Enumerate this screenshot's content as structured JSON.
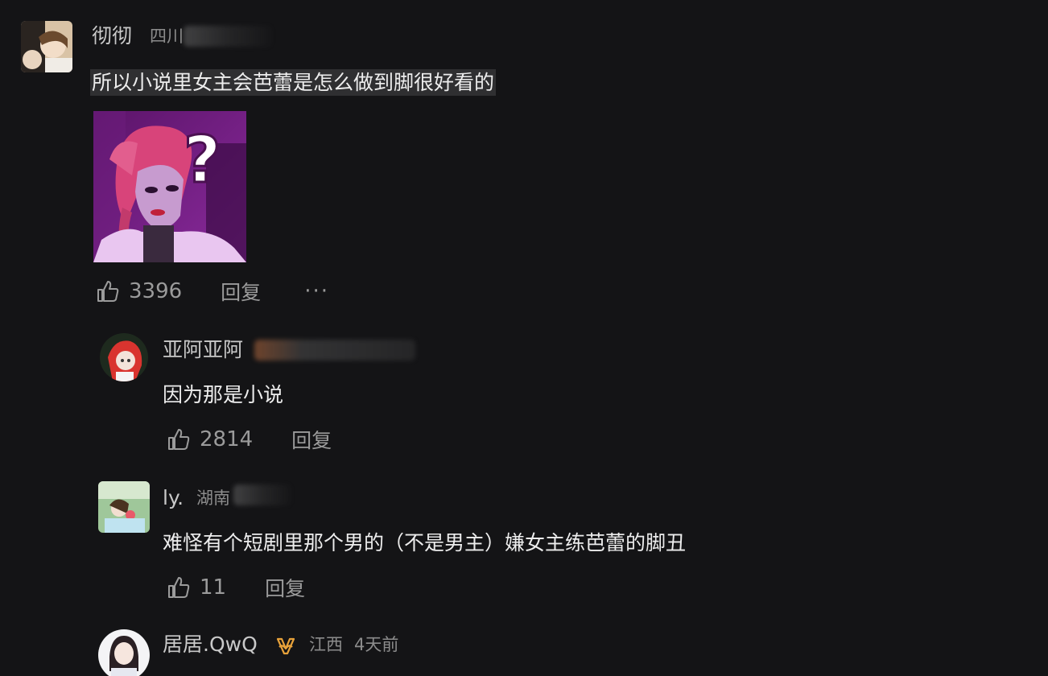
{
  "main_comment": {
    "username": "彻彻",
    "location": "四川",
    "text": "所以小说里女主会芭蕾是怎么做到脚很好看的",
    "sticker_icon": "question-mark-sticker",
    "likes": "3396",
    "reply_label": "回复",
    "more_label": "···"
  },
  "replies": [
    {
      "username": "亚阿亚阿",
      "text": "因为那是小说",
      "likes": "2814",
      "reply_label": "回复"
    },
    {
      "username": "ly.",
      "location": "湖南",
      "text": "难怪有个短剧里那个男的（不是男主）嫌女主练芭蕾的脚丑",
      "likes": "11",
      "reply_label": "回复"
    },
    {
      "username": "居居.QwQ",
      "badge_icon": "vip-badge-icon",
      "location": "江西",
      "time": "4天前"
    }
  ],
  "colors": {
    "background": "#141416",
    "text": "#ededed",
    "muted": "#9b9b9b",
    "badge": "#e8a23a"
  }
}
